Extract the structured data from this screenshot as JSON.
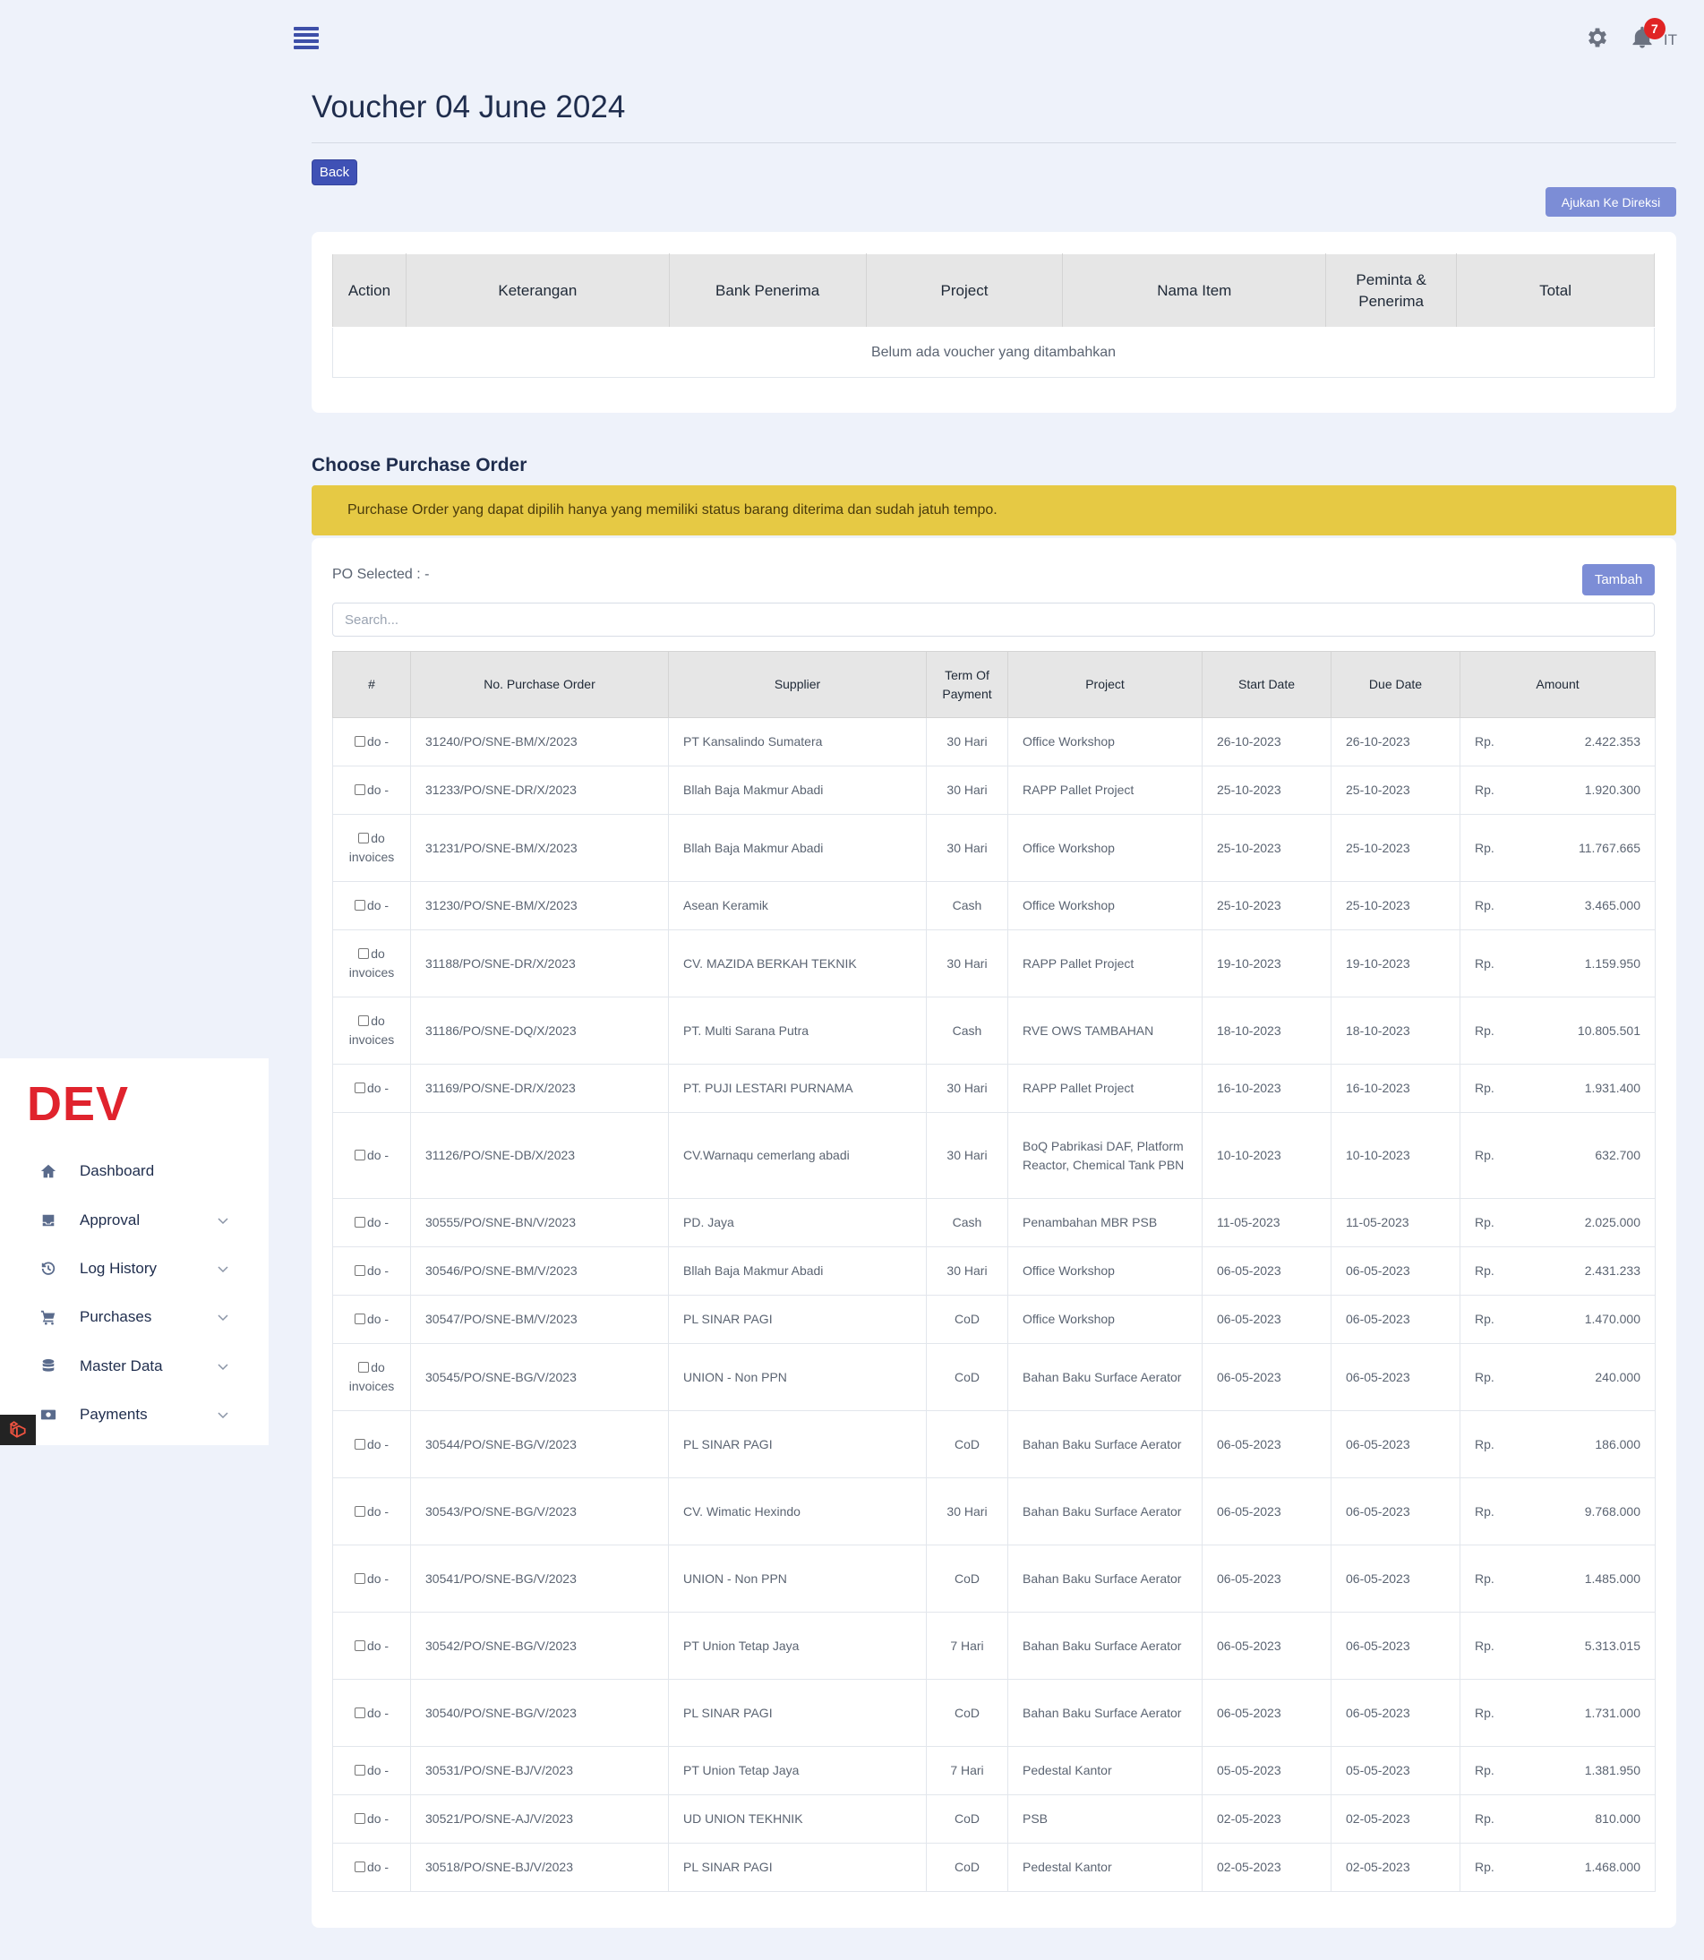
{
  "header": {
    "notifications_count": "7",
    "user_initials": "IT"
  },
  "page": {
    "title": "Voucher 04 June 2024",
    "back_label": "Back",
    "submit_label": "Ajukan Ke Direksi"
  },
  "voucher_table": {
    "columns": [
      "Action",
      "Keterangan",
      "Bank Penerima",
      "Project",
      "Nama Item",
      "Peminta & Penerima",
      "Total"
    ],
    "empty_message": "Belum ada voucher yang ditambahkan"
  },
  "purchase_order": {
    "heading": "Choose Purchase Order",
    "alert": "Purchase Order yang dapat dipilih hanya yang memiliki status barang diterima dan sudah jatuh tempo.",
    "selected_label": "PO Selected :  -",
    "add_label": "Tambah",
    "search_placeholder": "Search...",
    "columns": [
      "#",
      "No. Purchase Order",
      "Supplier",
      "Term Of Payment",
      "Project",
      "Start Date",
      "Due Date",
      "Amount"
    ],
    "rows": [
      {
        "doc": "do -",
        "po": "31240/PO/SNE-BM/X/2023",
        "supplier": "PT Kansalindo Sumatera",
        "term": "30 Hari",
        "project": "Office Workshop",
        "start": "26-10-2023",
        "due": "26-10-2023",
        "currency": "Rp.",
        "amount": "2.422.353"
      },
      {
        "doc": "do -",
        "po": "31233/PO/SNE-DR/X/2023",
        "supplier": "Bllah Baja Makmur Abadi",
        "term": "30 Hari",
        "project": "RAPP Pallet Project",
        "start": "25-10-2023",
        "due": "25-10-2023",
        "currency": "Rp.",
        "amount": "1.920.300"
      },
      {
        "doc": "do invoices",
        "po": "31231/PO/SNE-BM/X/2023",
        "supplier": "Bllah Baja Makmur Abadi",
        "term": "30 Hari",
        "project": "Office Workshop",
        "start": "25-10-2023",
        "due": "25-10-2023",
        "currency": "Rp.",
        "amount": "11.767.665"
      },
      {
        "doc": "do -",
        "po": "31230/PO/SNE-BM/X/2023",
        "supplier": "Asean Keramik",
        "term": "Cash",
        "project": "Office Workshop",
        "start": "25-10-2023",
        "due": "25-10-2023",
        "currency": "Rp.",
        "amount": "3.465.000"
      },
      {
        "doc": "do invoices",
        "po": "31188/PO/SNE-DR/X/2023",
        "supplier": "CV. MAZIDA BERKAH TEKNIK",
        "term": "30 Hari",
        "project": "RAPP Pallet Project",
        "start": "19-10-2023",
        "due": "19-10-2023",
        "currency": "Rp.",
        "amount": "1.159.950"
      },
      {
        "doc": "do invoices",
        "po": "31186/PO/SNE-DQ/X/2023",
        "supplier": "PT. Multi Sarana Putra",
        "term": "Cash",
        "project": "RVE OWS TAMBAHAN",
        "start": "18-10-2023",
        "due": "18-10-2023",
        "currency": "Rp.",
        "amount": "10.805.501"
      },
      {
        "doc": "do -",
        "po": "31169/PO/SNE-DR/X/2023",
        "supplier": "PT. PUJI LESTARI PURNAMA",
        "term": "30 Hari",
        "project": "RAPP Pallet Project",
        "start": "16-10-2023",
        "due": "16-10-2023",
        "currency": "Rp.",
        "amount": "1.931.400"
      },
      {
        "doc": "do -",
        "po": "31126/PO/SNE-DB/X/2023",
        "supplier": "CV.Warnaqu cemerlang abadi",
        "term": "30 Hari",
        "project": "BoQ Pabrikasi DAF, Platform Reactor, Chemical Tank PBN",
        "start": "10-10-2023",
        "due": "10-10-2023",
        "currency": "Rp.",
        "amount": "632.700"
      },
      {
        "doc": "do -",
        "po": "30555/PO/SNE-BN/V/2023",
        "supplier": "PD. Jaya",
        "term": "Cash",
        "project": "Penambahan MBR PSB",
        "start": "11-05-2023",
        "due": "11-05-2023",
        "currency": "Rp.",
        "amount": "2.025.000"
      },
      {
        "doc": "do -",
        "po": "30546/PO/SNE-BM/V/2023",
        "supplier": "Bllah Baja Makmur Abadi",
        "term": "30 Hari",
        "project": "Office Workshop",
        "start": "06-05-2023",
        "due": "06-05-2023",
        "currency": "Rp.",
        "amount": "2.431.233"
      },
      {
        "doc": "do -",
        "po": "30547/PO/SNE-BM/V/2023",
        "supplier": "PL SINAR PAGI",
        "term": "CoD",
        "project": "Office Workshop",
        "start": "06-05-2023",
        "due": "06-05-2023",
        "currency": "Rp.",
        "amount": "1.470.000"
      },
      {
        "doc": "do invoices",
        "po": "30545/PO/SNE-BG/V/2023",
        "supplier": "UNION - Non PPN",
        "term": "CoD",
        "project": "Bahan Baku Surface Aerator",
        "start": "06-05-2023",
        "due": "06-05-2023",
        "currency": "Rp.",
        "amount": "240.000"
      },
      {
        "doc": "do -",
        "po": "30544/PO/SNE-BG/V/2023",
        "supplier": "PL SINAR PAGI",
        "term": "CoD",
        "project": "Bahan Baku Surface Aerator",
        "start": "06-05-2023",
        "due": "06-05-2023",
        "currency": "Rp.",
        "amount": "186.000"
      },
      {
        "doc": "do -",
        "po": "30543/PO/SNE-BG/V/2023",
        "supplier": "CV. Wimatic Hexindo",
        "term": "30 Hari",
        "project": "Bahan Baku Surface Aerator",
        "start": "06-05-2023",
        "due": "06-05-2023",
        "currency": "Rp.",
        "amount": "9.768.000"
      },
      {
        "doc": "do -",
        "po": "30541/PO/SNE-BG/V/2023",
        "supplier": "UNION - Non PPN",
        "term": "CoD",
        "project": "Bahan Baku Surface Aerator",
        "start": "06-05-2023",
        "due": "06-05-2023",
        "currency": "Rp.",
        "amount": "1.485.000"
      },
      {
        "doc": "do -",
        "po": "30542/PO/SNE-BG/V/2023",
        "supplier": "PT Union Tetap Jaya",
        "term": "7 Hari",
        "project": "Bahan Baku Surface Aerator",
        "start": "06-05-2023",
        "due": "06-05-2023",
        "currency": "Rp.",
        "amount": "5.313.015"
      },
      {
        "doc": "do -",
        "po": "30540/PO/SNE-BG/V/2023",
        "supplier": "PL SINAR PAGI",
        "term": "CoD",
        "project": "Bahan Baku Surface Aerator",
        "start": "06-05-2023",
        "due": "06-05-2023",
        "currency": "Rp.",
        "amount": "1.731.000"
      },
      {
        "doc": "do -",
        "po": "30531/PO/SNE-BJ/V/2023",
        "supplier": "PT Union Tetap Jaya",
        "term": "7 Hari",
        "project": "Pedestal Kantor",
        "start": "05-05-2023",
        "due": "05-05-2023",
        "currency": "Rp.",
        "amount": "1.381.950"
      },
      {
        "doc": "do -",
        "po": "30521/PO/SNE-AJ/V/2023",
        "supplier": "UD UNION TEKHNIK",
        "term": "CoD",
        "project": "PSB",
        "start": "02-05-2023",
        "due": "02-05-2023",
        "currency": "Rp.",
        "amount": "810.000"
      },
      {
        "doc": "do -",
        "po": "30518/PO/SNE-BJ/V/2023",
        "supplier": "PL SINAR PAGI",
        "term": "CoD",
        "project": "Pedestal Kantor",
        "start": "02-05-2023",
        "due": "02-05-2023",
        "currency": "Rp.",
        "amount": "1.468.000"
      }
    ]
  },
  "sidebar": {
    "brand": "DEV",
    "items": [
      {
        "label": "Dashboard",
        "icon": "home-icon",
        "expandable": false
      },
      {
        "label": "Approval",
        "icon": "inbox-check-icon",
        "expandable": true
      },
      {
        "label": "Log History",
        "icon": "history-icon",
        "expandable": true
      },
      {
        "label": "Purchases",
        "icon": "cart-icon",
        "expandable": true
      },
      {
        "label": "Master Data",
        "icon": "database-icon",
        "expandable": true
      },
      {
        "label": "Payments",
        "icon": "cash-icon",
        "expandable": true
      }
    ]
  },
  "colors": {
    "primary": "#3f51b5",
    "primary_light": "#7c8dd6",
    "alert": "#e6c944",
    "brand_red": "#e0232d",
    "badge_red": "#e02424"
  }
}
